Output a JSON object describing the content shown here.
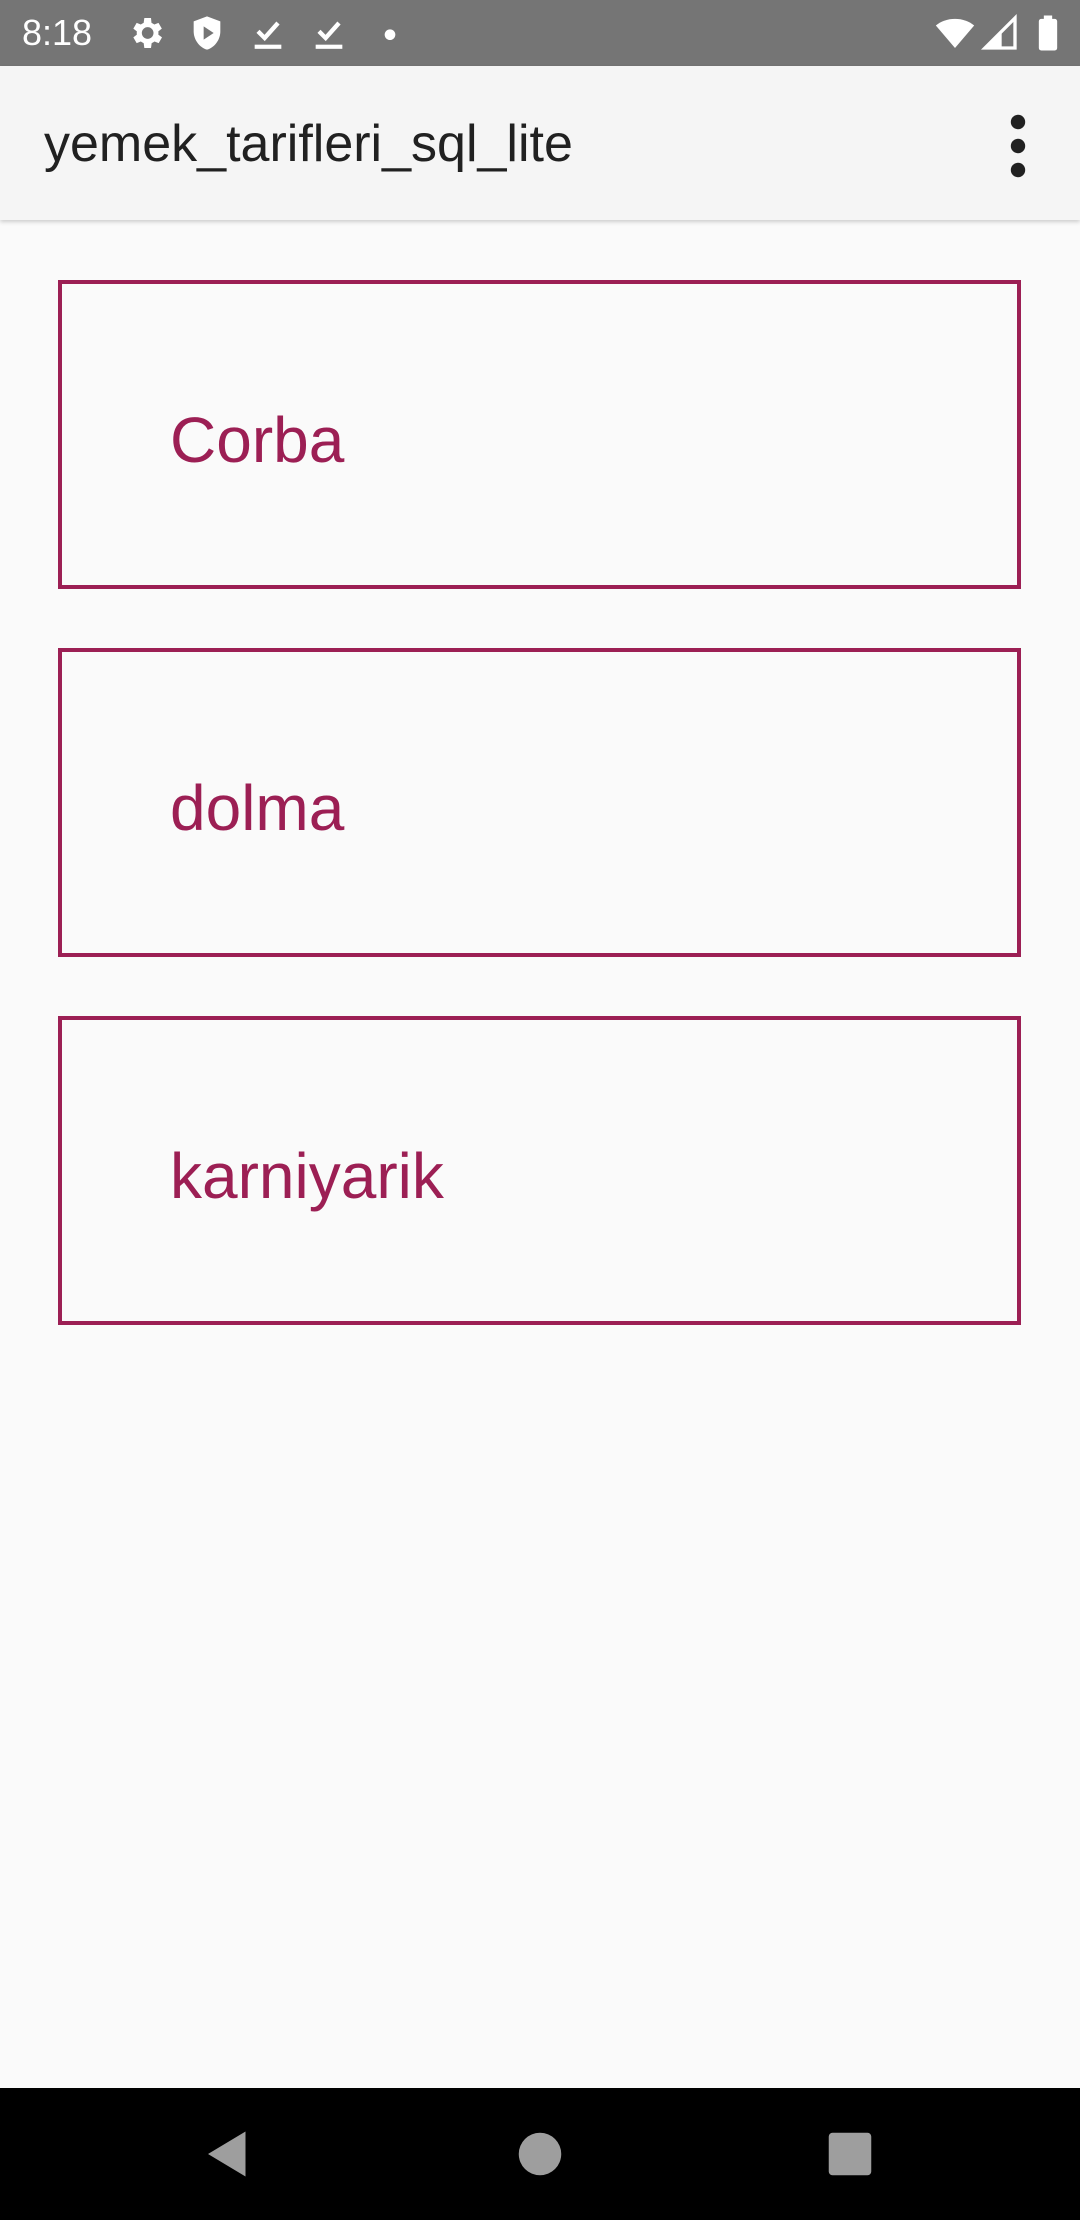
{
  "status_bar": {
    "time": "8:18",
    "left_icons": [
      "gear-icon",
      "shield-play-icon",
      "download-check-icon",
      "download-check-icon",
      "dot-icon"
    ],
    "right_icons": [
      "wifi-icon",
      "cell-signal-icon",
      "battery-icon"
    ]
  },
  "app_bar": {
    "title": "yemek_tarifleri_sql_lite",
    "overflow_icon": "more-vert-icon"
  },
  "recipes": [
    {
      "label": "Corba"
    },
    {
      "label": "dolma"
    },
    {
      "label": "karniyarik"
    }
  ],
  "nav_bar": {
    "buttons": [
      "back-icon",
      "home-icon",
      "recents-icon"
    ]
  },
  "colors": {
    "accent": "#9C1F54",
    "status_bar": "#757575",
    "app_bar": "#F5F5F5",
    "background": "#FAFAFA",
    "nav_bar": "#000000"
  }
}
